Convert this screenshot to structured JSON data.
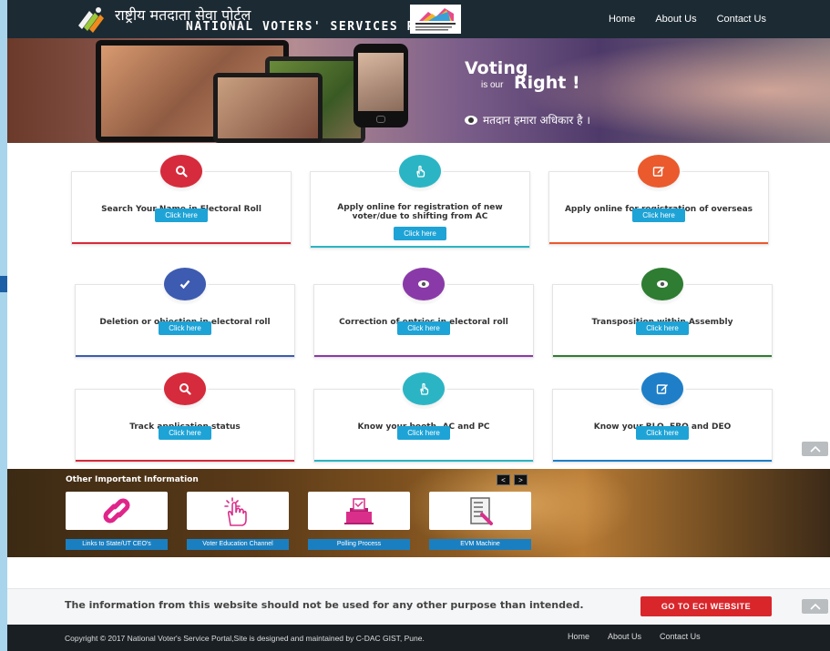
{
  "header": {
    "title_hindi": "राष्ट्रीय मतदाता सेवा पोर्टल",
    "title_english": "NATIONAL VOTERS' SERVICES PORTAL",
    "nav": [
      "Home",
      "About Us",
      "Contact Us"
    ]
  },
  "banner": {
    "voting": "Voting",
    "is_our": "is our",
    "right": "Right !",
    "hindi_slogan": "मतदान हमारा अधिकार है ।"
  },
  "services": [
    {
      "label": "Search Your Name in Electoral Roll",
      "button": "Click here",
      "icon": "search-icon",
      "color": "#d62b3c"
    },
    {
      "label": "Apply online for registration of new voter/due to shifting from AC",
      "button": "Click here",
      "icon": "hand-pointer-icon",
      "color": "#2bb5c4"
    },
    {
      "label": "Apply online for registration of overseas voter",
      "button": "Click here",
      "icon": "edit-icon",
      "color": "#ea5a2d"
    },
    {
      "label": "Deletion or objection in electoral roll",
      "button": "Click here",
      "icon": "check-icon",
      "color": "#3d5bb0"
    },
    {
      "label": "Correction of entries in electoral roll",
      "button": "Click here",
      "icon": "eye-icon",
      "color": "#8a3aa8"
    },
    {
      "label": "Transposition within Assembly",
      "button": "Click here",
      "icon": "eye-icon",
      "color": "#2e7d32"
    },
    {
      "label": "Track application status",
      "button": "Click here",
      "icon": "search-icon",
      "color": "#d62b3c"
    },
    {
      "label": "Know your booth, AC and PC",
      "button": "Click here",
      "icon": "hand-pointer-icon",
      "color": "#2bb5c4"
    },
    {
      "label": "Know your BLO, ERO and DEO",
      "button": "Click here",
      "icon": "edit-icon",
      "color": "#1e7fc8"
    }
  ],
  "other_info": {
    "title": "Other Important Information",
    "prev": "<",
    "next": ">",
    "tiles": [
      {
        "label": "Links to State/UT CEO's",
        "icon": "link-icon"
      },
      {
        "label": "Voter Education Channel",
        "icon": "touch-hand-icon"
      },
      {
        "label": "Polling Process",
        "icon": "ballot-box-icon"
      },
      {
        "label": "EVM Machine",
        "icon": "evm-icon"
      }
    ]
  },
  "disclaimer": {
    "text": "The information from this website should not be used for any other purpose than intended.",
    "button": "GO TO ECI WEBSITE"
  },
  "footer": {
    "copyright": "Copyright © 2017 National Voter's Service Portal,Site is designed and maintained by C-DAC GIST, Pune.",
    "nav": [
      "Home",
      "About Us",
      "Contact Us"
    ]
  }
}
